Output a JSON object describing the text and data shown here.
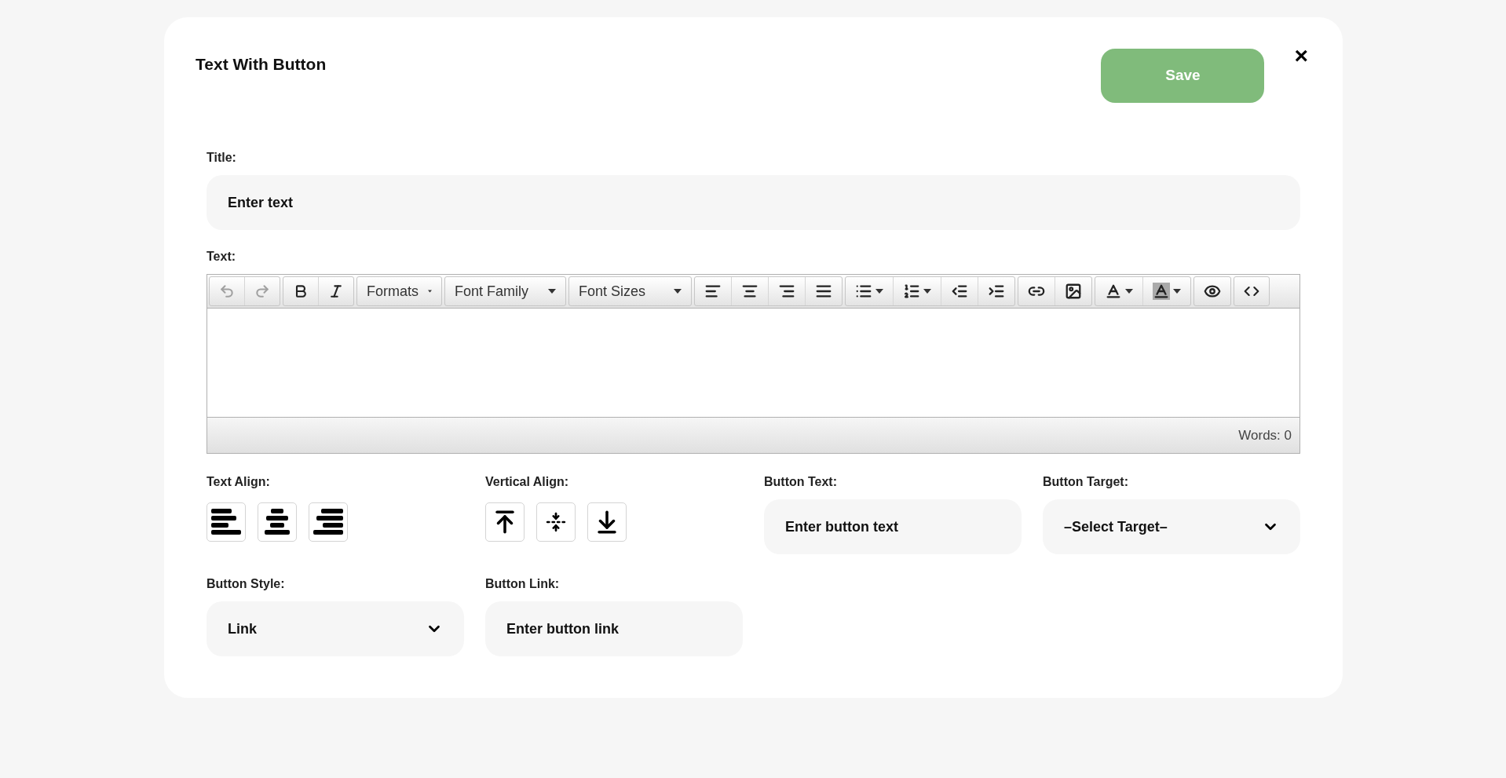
{
  "dialog": {
    "title": "Text With Button",
    "save_button": "Save",
    "close_button": "×"
  },
  "title_field": {
    "label": "Title:",
    "placeholder": "Enter text"
  },
  "text_editor": {
    "label": "Text:",
    "undo": {
      "disabled": true
    },
    "redo": {
      "disabled": true
    },
    "menus": [
      "Formats",
      "Font Family",
      "Font Sizes"
    ],
    "word_count": "Words: 0"
  },
  "text_align": {
    "label": "Text Align:"
  },
  "vertical_align": {
    "label": "Vertical Align:"
  },
  "button_text": {
    "label": "Button Text:",
    "placeholder": "Enter button text"
  },
  "button_target": {
    "label": "Button Target:",
    "value": "–Select Target–"
  },
  "button_style": {
    "label": "Button Style:",
    "value": "Link"
  },
  "button_link": {
    "label": "Button Link:",
    "placeholder": "Enter button link"
  }
}
